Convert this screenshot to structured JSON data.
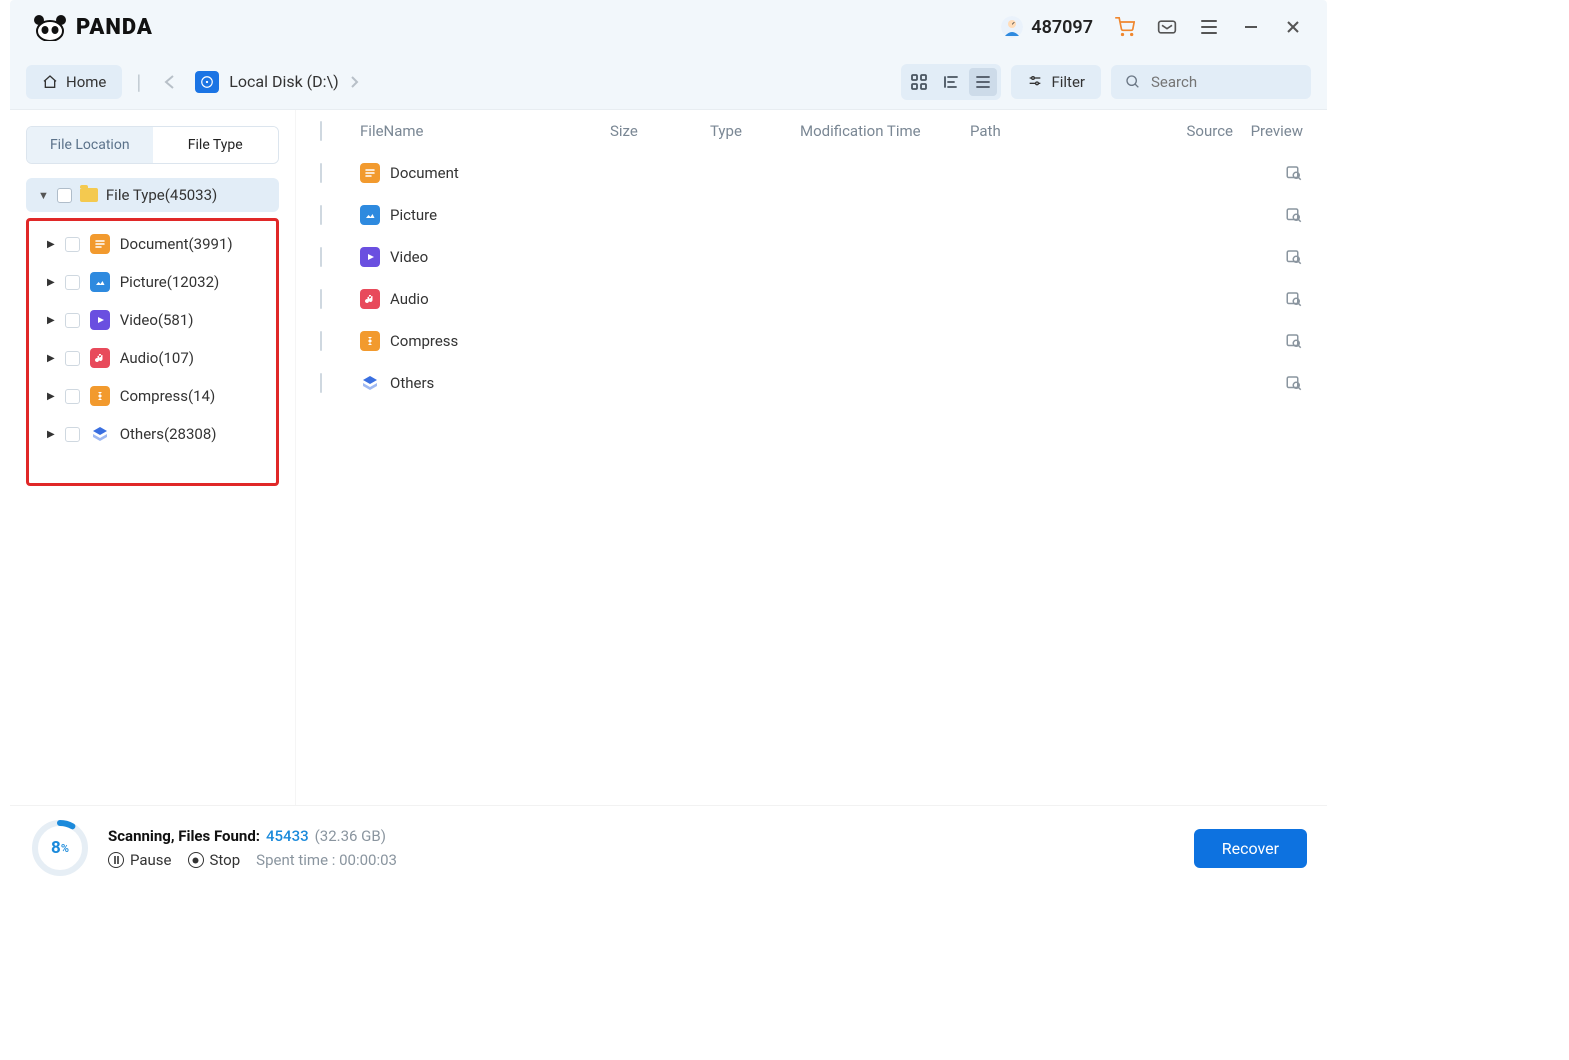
{
  "app_name": "PANDA",
  "titlebar": {
    "user_id": "487097"
  },
  "toolbar": {
    "home_label": "Home",
    "breadcrumb": "Local Disk (D:\\)",
    "filter_label": "Filter",
    "search_placeholder": "Search"
  },
  "sidebar": {
    "tabs": {
      "file_location": "File Location",
      "file_type": "File Type"
    },
    "root_label": "File Type(45033)",
    "items": [
      {
        "label": "Document(3991)",
        "icon": "doc"
      },
      {
        "label": "Picture(12032)",
        "icon": "pic"
      },
      {
        "label": "Video(581)",
        "icon": "vid"
      },
      {
        "label": "Audio(107)",
        "icon": "aud"
      },
      {
        "label": "Compress(14)",
        "icon": "zip"
      },
      {
        "label": "Others(28308)",
        "icon": "oth"
      }
    ]
  },
  "columns": {
    "name": "FileName",
    "size": "Size",
    "type": "Type",
    "mtime": "Modification Time",
    "path": "Path",
    "source": "Source",
    "preview": "Preview"
  },
  "rows": [
    {
      "label": "Document",
      "icon": "doc"
    },
    {
      "label": "Picture",
      "icon": "pic"
    },
    {
      "label": "Video",
      "icon": "vid"
    },
    {
      "label": "Audio",
      "icon": "aud"
    },
    {
      "label": "Compress",
      "icon": "zip"
    },
    {
      "label": "Others",
      "icon": "oth"
    }
  ],
  "status": {
    "percent": "8",
    "percent_unit": "%",
    "scanning_label": "Scanning, Files Found:",
    "found_count": "45433",
    "found_size": "(32.36 GB)",
    "pause_label": "Pause",
    "stop_label": "Stop",
    "spent_label": "Spent time : 00:00:03",
    "recover_label": "Recover"
  }
}
